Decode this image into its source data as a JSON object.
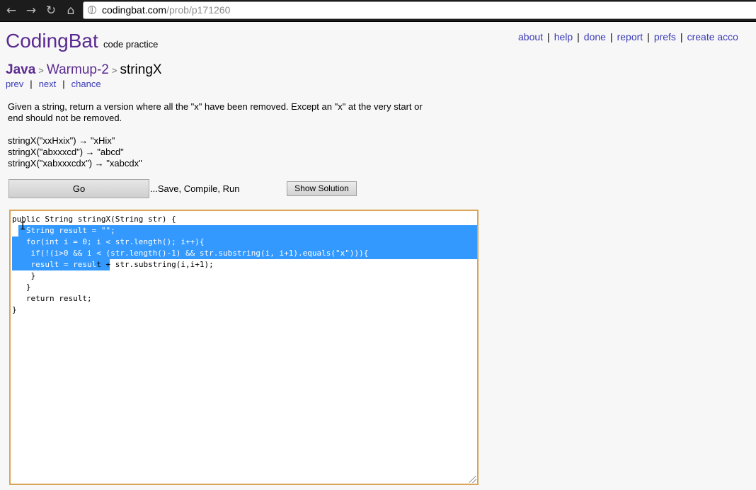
{
  "browser": {
    "back_icon": "←",
    "forward_icon": "→",
    "reload_icon": "↻",
    "home_icon": "⌂",
    "url_host": "codingbat.com",
    "url_path": "/prob/p171260"
  },
  "site": {
    "name": "CodingBat",
    "tagline": "code practice"
  },
  "top_nav": {
    "about": "about",
    "help": "help",
    "done": "done",
    "report": "report",
    "prefs": "prefs",
    "create_account": "create acco",
    "separator": "|"
  },
  "breadcrumb": {
    "language": "Java",
    "arrow": ">",
    "category": "Warmup-2",
    "problem": "stringX"
  },
  "subnav": {
    "prev": "prev",
    "next": "next",
    "chance": "chance",
    "separator": "|"
  },
  "problem": {
    "description_line1": "Given a string, return a version where all the \"x\" have been removed. Except an \"x\" at the very start or",
    "description_line2": "end should not be removed.",
    "examples": [
      "stringX(\"xxHxix\") → \"xHix\"",
      "stringX(\"abxxxcd\") → \"abcd\"",
      "stringX(\"xabxxxcdx\") → \"xabcdx\""
    ]
  },
  "actions": {
    "go_label": "Go",
    "save_text": "...Save, Compile, Run",
    "show_solution_label": "Show Solution"
  },
  "editor": {
    "lines": [
      "public String stringX(String str) {",
      "   String result = \"\";",
      "   for(int i = 0; i < str.length(); i++){",
      "    if(!(i>0 && i < (str.length()-1) && str.substring(i, i+1).equals(\"x\"))){",
      "    result = result + str.substring(i,i+1);",
      "    }",
      "   }",
      "   return result;",
      "}"
    ],
    "selection_color": "#3399ff"
  },
  "colors": {
    "brand": "#5a2a90",
    "link": "#3b3bb8",
    "editor_border": "#d9a456"
  }
}
